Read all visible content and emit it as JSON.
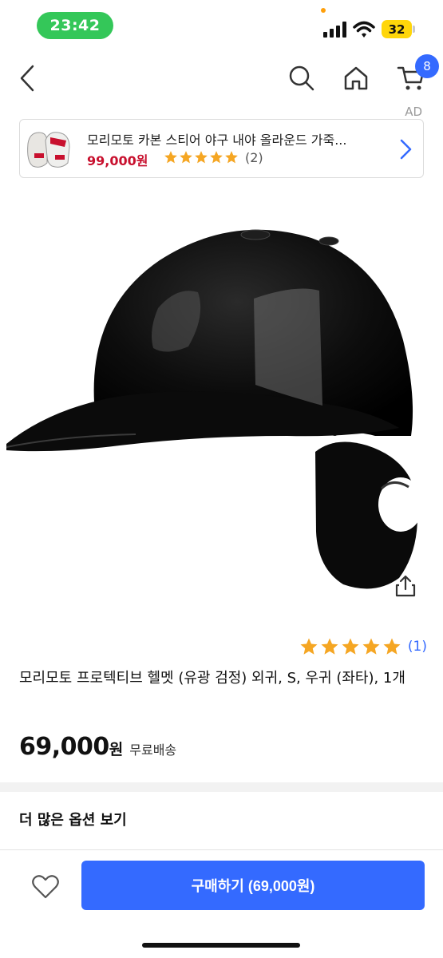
{
  "status_bar": {
    "time": "23:42",
    "battery": "32"
  },
  "nav": {
    "cart_count": "8"
  },
  "ad": {
    "label": "AD",
    "title": "모리모토 카본 스티어 야구 내야 올라운드 가죽...",
    "price": "99,000원",
    "rating_count": "(2)",
    "stars": 5
  },
  "product": {
    "rating_count": "(1)",
    "stars": 5,
    "title": "모리모토 프로텍티브 헬멧 (유광 검정) 외귀, S, 우귀 (좌타), 1개",
    "price": "69,000",
    "currency": "원",
    "shipping": "무료배송"
  },
  "options": {
    "more_label": "더 많은 옵션 보기"
  },
  "bottom_bar": {
    "buy_label": "구매하기 (69,000원)"
  },
  "colors": {
    "accent": "#346aff",
    "price_red": "#c8102e",
    "star": "#f5a623",
    "time_pill": "#34c759",
    "battery": "#ffd60a"
  },
  "icons": [
    "back-icon",
    "search-icon",
    "home-icon",
    "cart-icon",
    "chevron-right-icon",
    "star-icon",
    "share-icon",
    "heart-icon"
  ]
}
